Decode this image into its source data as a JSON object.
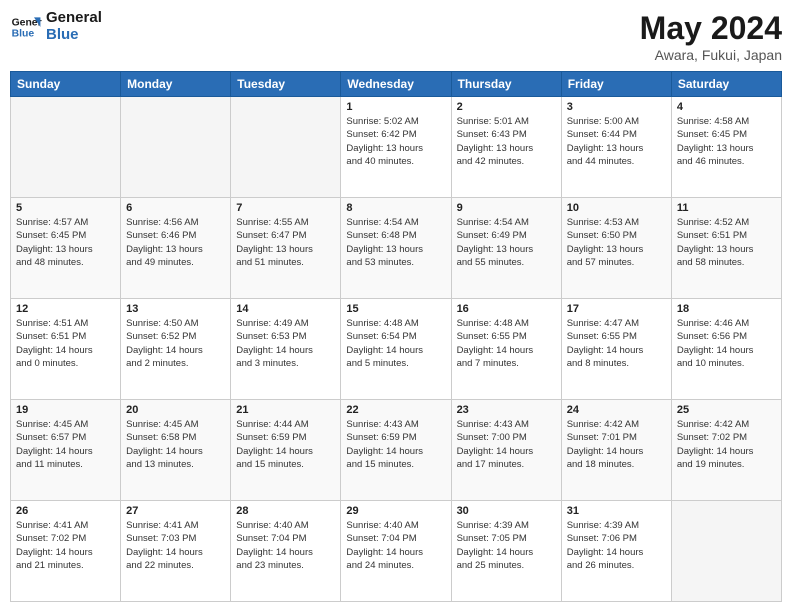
{
  "header": {
    "logo_text_general": "General",
    "logo_text_blue": "Blue",
    "title": "May 2024",
    "subtitle": "Awara, Fukui, Japan"
  },
  "calendar": {
    "days_of_week": [
      "Sunday",
      "Monday",
      "Tuesday",
      "Wednesday",
      "Thursday",
      "Friday",
      "Saturday"
    ],
    "weeks": [
      [
        {
          "day": "",
          "info": ""
        },
        {
          "day": "",
          "info": ""
        },
        {
          "day": "",
          "info": ""
        },
        {
          "day": "1",
          "info": "Sunrise: 5:02 AM\nSunset: 6:42 PM\nDaylight: 13 hours\nand 40 minutes."
        },
        {
          "day": "2",
          "info": "Sunrise: 5:01 AM\nSunset: 6:43 PM\nDaylight: 13 hours\nand 42 minutes."
        },
        {
          "day": "3",
          "info": "Sunrise: 5:00 AM\nSunset: 6:44 PM\nDaylight: 13 hours\nand 44 minutes."
        },
        {
          "day": "4",
          "info": "Sunrise: 4:58 AM\nSunset: 6:45 PM\nDaylight: 13 hours\nand 46 minutes."
        }
      ],
      [
        {
          "day": "5",
          "info": "Sunrise: 4:57 AM\nSunset: 6:45 PM\nDaylight: 13 hours\nand 48 minutes."
        },
        {
          "day": "6",
          "info": "Sunrise: 4:56 AM\nSunset: 6:46 PM\nDaylight: 13 hours\nand 49 minutes."
        },
        {
          "day": "7",
          "info": "Sunrise: 4:55 AM\nSunset: 6:47 PM\nDaylight: 13 hours\nand 51 minutes."
        },
        {
          "day": "8",
          "info": "Sunrise: 4:54 AM\nSunset: 6:48 PM\nDaylight: 13 hours\nand 53 minutes."
        },
        {
          "day": "9",
          "info": "Sunrise: 4:54 AM\nSunset: 6:49 PM\nDaylight: 13 hours\nand 55 minutes."
        },
        {
          "day": "10",
          "info": "Sunrise: 4:53 AM\nSunset: 6:50 PM\nDaylight: 13 hours\nand 57 minutes."
        },
        {
          "day": "11",
          "info": "Sunrise: 4:52 AM\nSunset: 6:51 PM\nDaylight: 13 hours\nand 58 minutes."
        }
      ],
      [
        {
          "day": "12",
          "info": "Sunrise: 4:51 AM\nSunset: 6:51 PM\nDaylight: 14 hours\nand 0 minutes."
        },
        {
          "day": "13",
          "info": "Sunrise: 4:50 AM\nSunset: 6:52 PM\nDaylight: 14 hours\nand 2 minutes."
        },
        {
          "day": "14",
          "info": "Sunrise: 4:49 AM\nSunset: 6:53 PM\nDaylight: 14 hours\nand 3 minutes."
        },
        {
          "day": "15",
          "info": "Sunrise: 4:48 AM\nSunset: 6:54 PM\nDaylight: 14 hours\nand 5 minutes."
        },
        {
          "day": "16",
          "info": "Sunrise: 4:48 AM\nSunset: 6:55 PM\nDaylight: 14 hours\nand 7 minutes."
        },
        {
          "day": "17",
          "info": "Sunrise: 4:47 AM\nSunset: 6:55 PM\nDaylight: 14 hours\nand 8 minutes."
        },
        {
          "day": "18",
          "info": "Sunrise: 4:46 AM\nSunset: 6:56 PM\nDaylight: 14 hours\nand 10 minutes."
        }
      ],
      [
        {
          "day": "19",
          "info": "Sunrise: 4:45 AM\nSunset: 6:57 PM\nDaylight: 14 hours\nand 11 minutes."
        },
        {
          "day": "20",
          "info": "Sunrise: 4:45 AM\nSunset: 6:58 PM\nDaylight: 14 hours\nand 13 minutes."
        },
        {
          "day": "21",
          "info": "Sunrise: 4:44 AM\nSunset: 6:59 PM\nDaylight: 14 hours\nand 15 minutes."
        },
        {
          "day": "22",
          "info": "Sunrise: 4:43 AM\nSunset: 6:59 PM\nDaylight: 14 hours\nand 15 minutes."
        },
        {
          "day": "23",
          "info": "Sunrise: 4:43 AM\nSunset: 7:00 PM\nDaylight: 14 hours\nand 17 minutes."
        },
        {
          "day": "24",
          "info": "Sunrise: 4:42 AM\nSunset: 7:01 PM\nDaylight: 14 hours\nand 18 minutes."
        },
        {
          "day": "25",
          "info": "Sunrise: 4:42 AM\nSunset: 7:02 PM\nDaylight: 14 hours\nand 19 minutes."
        }
      ],
      [
        {
          "day": "26",
          "info": "Sunrise: 4:41 AM\nSunset: 7:02 PM\nDaylight: 14 hours\nand 21 minutes."
        },
        {
          "day": "27",
          "info": "Sunrise: 4:41 AM\nSunset: 7:03 PM\nDaylight: 14 hours\nand 22 minutes."
        },
        {
          "day": "28",
          "info": "Sunrise: 4:40 AM\nSunset: 7:04 PM\nDaylight: 14 hours\nand 23 minutes."
        },
        {
          "day": "29",
          "info": "Sunrise: 4:40 AM\nSunset: 7:04 PM\nDaylight: 14 hours\nand 24 minutes."
        },
        {
          "day": "30",
          "info": "Sunrise: 4:39 AM\nSunset: 7:05 PM\nDaylight: 14 hours\nand 25 minutes."
        },
        {
          "day": "31",
          "info": "Sunrise: 4:39 AM\nSunset: 7:06 PM\nDaylight: 14 hours\nand 26 minutes."
        },
        {
          "day": "",
          "info": ""
        }
      ]
    ]
  }
}
